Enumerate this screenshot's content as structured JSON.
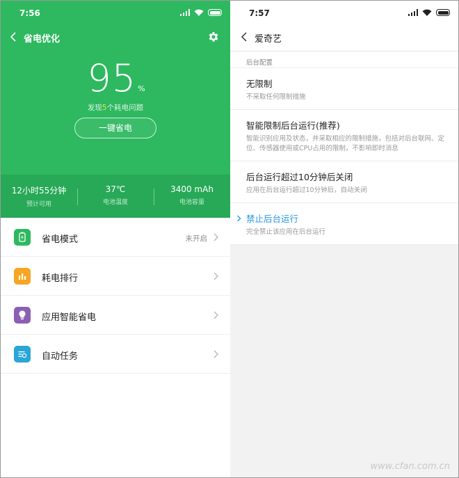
{
  "left": {
    "status": {
      "time": "7:56"
    },
    "header": {
      "title": "省电优化"
    },
    "battery": {
      "percent": "95",
      "unit": "%"
    },
    "issues": {
      "prefix": "发现",
      "count": "5",
      "suffix": "个耗电问题"
    },
    "one_click": "一键省电",
    "stats": [
      {
        "value": "12小时55分钟",
        "label": "预计可用"
      },
      {
        "value": "37℃",
        "label": "电池温度"
      },
      {
        "value": "3400 mAh",
        "label": "电池容量"
      }
    ],
    "menu": [
      {
        "label": "省电模式",
        "right": "未开启",
        "icon": "battery-mode-icon",
        "color": "#2eb860"
      },
      {
        "label": "耗电排行",
        "right": "",
        "icon": "ranking-chart-icon",
        "color": "#f6a623"
      },
      {
        "label": "应用智能省电",
        "right": "",
        "icon": "lightbulb-icon",
        "color": "#8d5fb3"
      },
      {
        "label": "自动任务",
        "right": "",
        "icon": "task-list-icon",
        "color": "#2aa6d8"
      }
    ]
  },
  "right": {
    "status": {
      "time": "7:57"
    },
    "header": {
      "title": "爱奇艺"
    },
    "section_label": "后台配置",
    "options": [
      {
        "title": "无限制",
        "desc": "不采取任何限制措施"
      },
      {
        "title": "智能限制后台运行(推荐)",
        "desc": "智能识别应用及状态，并采取相应的限制措施，包括对后台联网、定位、传感器使用或CPU占用的限制，不影响即时消息"
      },
      {
        "title": "后台运行超过10分钟后关闭",
        "desc": "应用在后台运行超过10分钟后，自动关闭"
      },
      {
        "title": "禁止后台运行",
        "desc": "完全禁止该应用在后台运行",
        "selected": true
      }
    ],
    "accent_color": "#2897e3"
  },
  "watermark": "www.cfan.com.cn"
}
